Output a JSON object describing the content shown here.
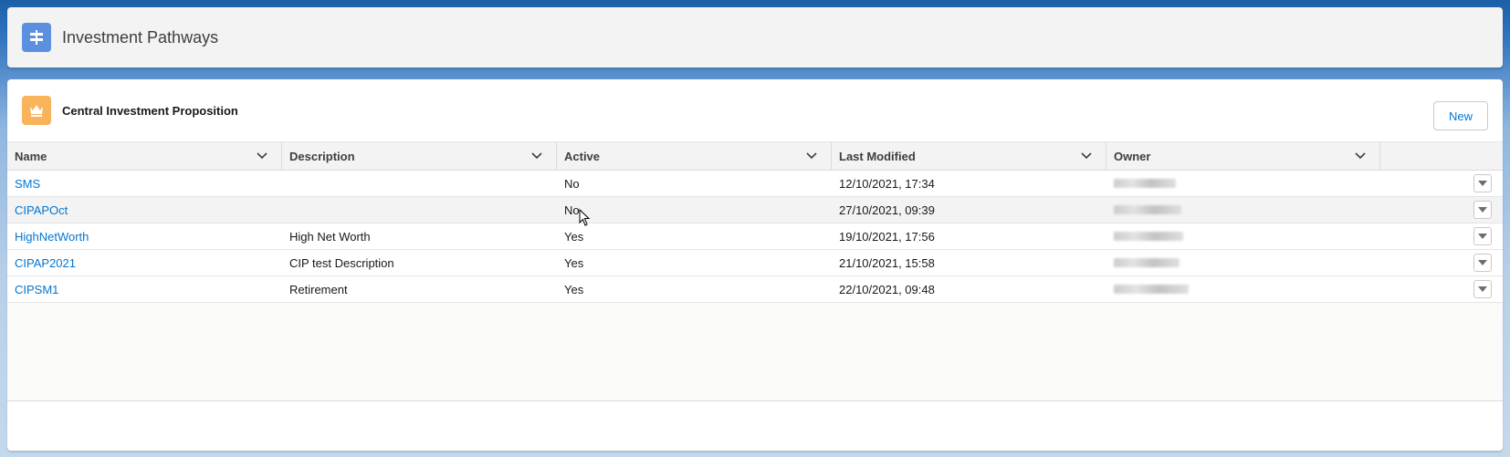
{
  "header": {
    "title": "Investment Pathways",
    "icon": "signpost-icon",
    "icon_color": "#5b8fe0"
  },
  "list": {
    "title": "Central Investment Proposition",
    "icon": "crown-icon",
    "icon_color": "#f9b35a",
    "new_label": "New",
    "columns": [
      "Name",
      "Description",
      "Active",
      "Last Modified",
      "Owner"
    ],
    "rows": [
      {
        "name": "SMS",
        "description": "",
        "active": "No",
        "modified": "12/10/2021, 17:34"
      },
      {
        "name": "CIPAPOct",
        "description": "",
        "active": "No",
        "modified": "27/10/2021, 09:39"
      },
      {
        "name": "HighNetWorth",
        "description": "High Net Worth",
        "active": "Yes",
        "modified": "19/10/2021, 17:56"
      },
      {
        "name": "CIPAP2021",
        "description": "CIP test Description",
        "active": "Yes",
        "modified": "21/10/2021, 15:58"
      },
      {
        "name": "CIPSM1",
        "description": "Retirement",
        "active": "Yes",
        "modified": "22/10/2021, 09:48"
      }
    ]
  },
  "colors": {
    "link": "#0176d3",
    "header_bg": "#f3f3f3"
  }
}
